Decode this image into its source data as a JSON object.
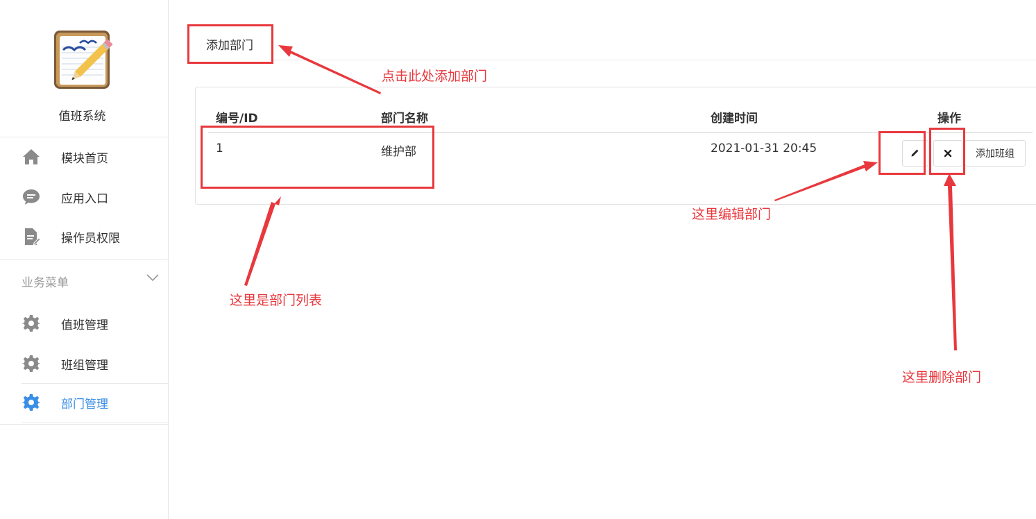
{
  "app": {
    "title": "值班系统"
  },
  "sidebar": {
    "items": [
      {
        "label": "模块首页",
        "icon": "home-icon"
      },
      {
        "label": "应用入口",
        "icon": "chat-icon"
      },
      {
        "label": "操作员权限",
        "icon": "document-edit-icon"
      }
    ],
    "group": {
      "title": "业务菜单",
      "items": [
        {
          "label": "值班管理",
          "icon": "gear-icon",
          "active": false
        },
        {
          "label": "班组管理",
          "icon": "gear-icon",
          "active": false
        },
        {
          "label": "部门管理",
          "icon": "gear-icon",
          "active": true
        }
      ]
    }
  },
  "toolbar": {
    "add_dept_label": "添加部门"
  },
  "table": {
    "columns": [
      "编号/ID",
      "部门名称",
      "创建时间",
      "操作"
    ],
    "rows": [
      {
        "id": "1",
        "name": "维护部",
        "created": "2021-01-31 20:45"
      }
    ],
    "actions": {
      "edit_icon": "pencil-icon",
      "delete_icon": "x-icon",
      "add_team_label": "添加班组"
    }
  },
  "annotations": {
    "add_hint": "点击此处添加部门",
    "list_hint": "这里是部门列表",
    "edit_hint": "这里编辑部门",
    "delete_hint": "这里删除部门"
  },
  "colors": {
    "accent": "#3a8ee6",
    "annotation": "#e8383d",
    "icon_gray": "#8a8a8a"
  }
}
